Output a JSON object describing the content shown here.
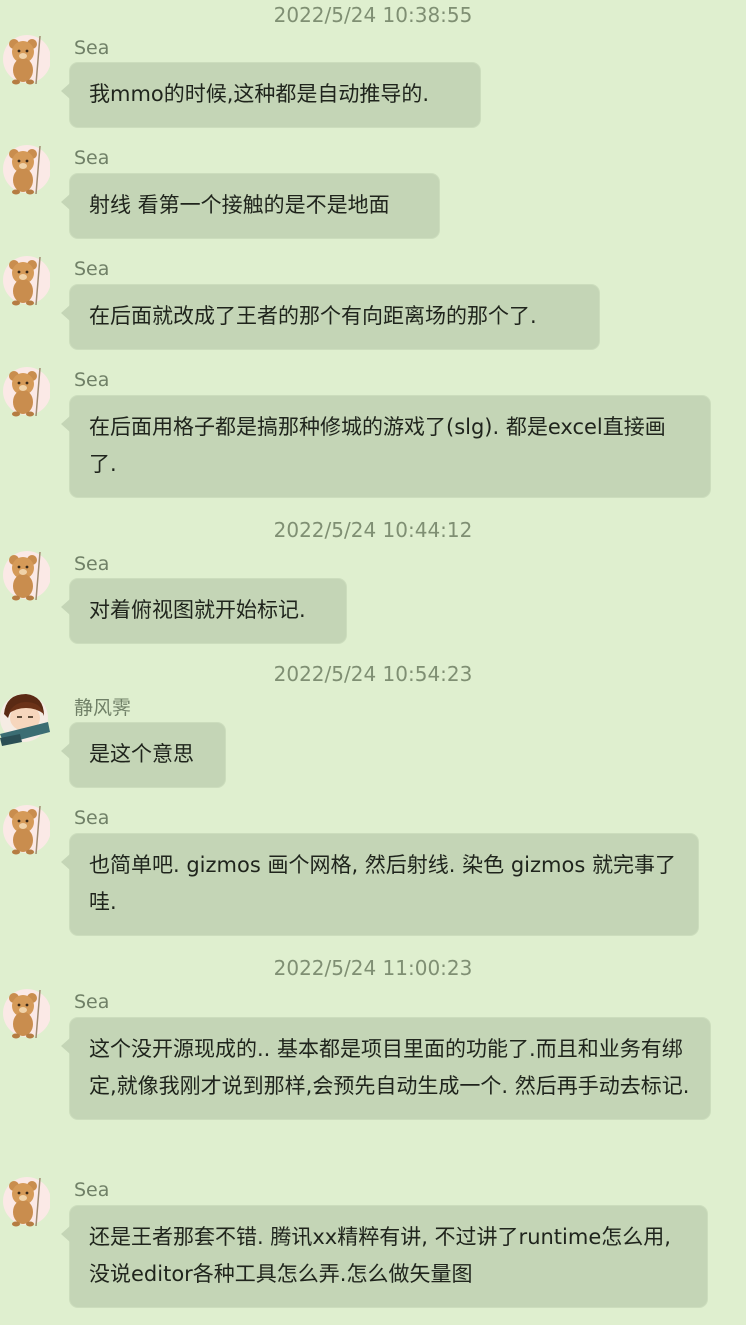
{
  "timestamps": [
    "2022/5/24 10:38:55",
    "2022/5/24 10:44:12",
    "2022/5/24 10:54:23",
    "2022/5/24 11:00:23"
  ],
  "messages": [
    {
      "sender": "Sea",
      "avatar": "bear-avatar-icon",
      "text": "我mmo的时候,这种都是自动推导的."
    },
    {
      "sender": "Sea",
      "avatar": "bear-avatar-icon",
      "text": "射线 看第一个接触的是不是地面"
    },
    {
      "sender": "Sea",
      "avatar": "bear-avatar-icon",
      "text": "在后面就改成了王者的那个有向距离场的那个了."
    },
    {
      "sender": "Sea",
      "avatar": "bear-avatar-icon",
      "text": "在后面用格子都是搞那种修城的游戏了(slg). 都是excel直接画了."
    },
    {
      "sender": "Sea",
      "avatar": "bear-avatar-icon",
      "text": "对着俯视图就开始标记."
    },
    {
      "sender": "静风霁",
      "avatar": "cartoon-person-avatar-icon",
      "text": "是这个意思"
    },
    {
      "sender": "Sea",
      "avatar": "bear-avatar-icon",
      "text": "也简单吧. gizmos 画个网格, 然后射线. 染色 gizmos 就完事了哇."
    },
    {
      "sender": "Sea",
      "avatar": "bear-avatar-icon",
      "text": "这个没开源现成的.. 基本都是项目里面的功能了.而且和业务有绑定,就像我刚才说到那样,会预先自动生成一个. 然后再手动去标记."
    },
    {
      "sender": "Sea",
      "avatar": "bear-avatar-icon",
      "text": "还是王者那套不错. 腾讯xx精粹有讲, 不过讲了runtime怎么用,没说editor各种工具怎么弄.怎么做矢量图"
    }
  ],
  "colors": {
    "background": "#dfefcf",
    "bubble": "#c4d5b6",
    "timestamp_text": "#7f8f73",
    "sender_text": "#708067",
    "message_text": "#1f241c"
  }
}
